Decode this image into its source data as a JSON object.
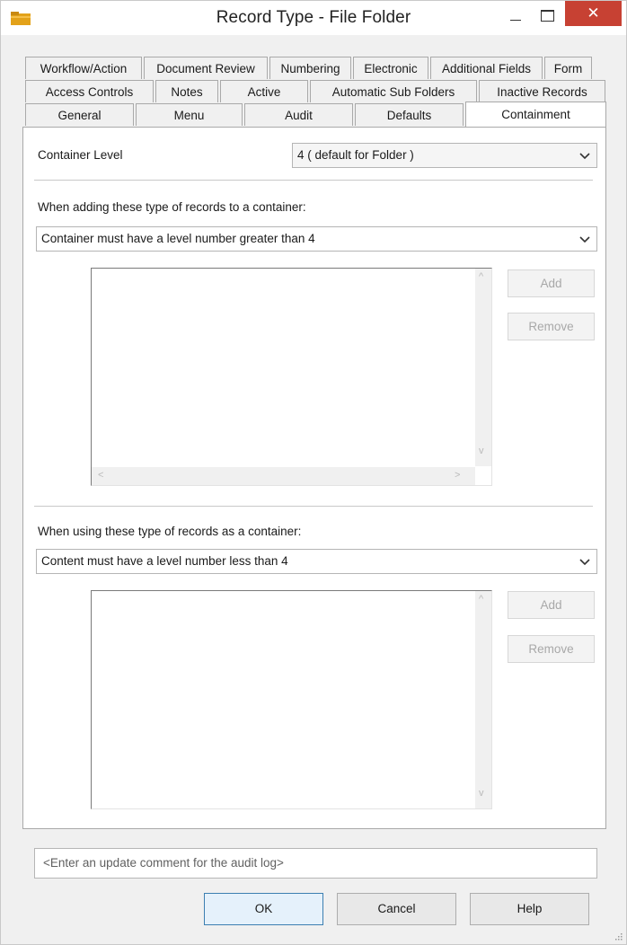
{
  "window": {
    "title": "Record Type - File Folder",
    "close_glyph": "✕"
  },
  "tabs": {
    "row1": [
      "Workflow/Action",
      "Document Review",
      "Numbering",
      "Electronic",
      "Additional Fields",
      "Form"
    ],
    "row2": [
      "Access Controls",
      "Notes",
      "Active",
      "Automatic Sub Folders",
      "Inactive Records"
    ],
    "row3": [
      "General",
      "Menu",
      "Audit",
      "Defaults",
      "Containment"
    ],
    "active": "Containment"
  },
  "containment": {
    "container_level_label": "Container Level",
    "container_level_value": "4   ( default for Folder )",
    "adding_label": "When adding these type of records to a container:",
    "adding_rule": "Container must have a level number greater than 4",
    "using_label": "When using these type of records as a container:",
    "using_rule": "Content must have a level number less than 4",
    "add_label": "Add",
    "remove_label": "Remove"
  },
  "footer": {
    "comment_placeholder": "<Enter an update comment for the audit log>",
    "ok_label": "OK",
    "cancel_label": "Cancel",
    "help_label": "Help"
  },
  "icons": {
    "app": "folder-icon",
    "chevron": "chevron-down-icon",
    "scroll_up": "^",
    "scroll_down": "v",
    "scroll_left": "<",
    "scroll_right": ">"
  },
  "colors": {
    "close_button": "#c74133",
    "default_button_border": "#3c7fb1",
    "default_button_fill": "#e5f1fb"
  }
}
